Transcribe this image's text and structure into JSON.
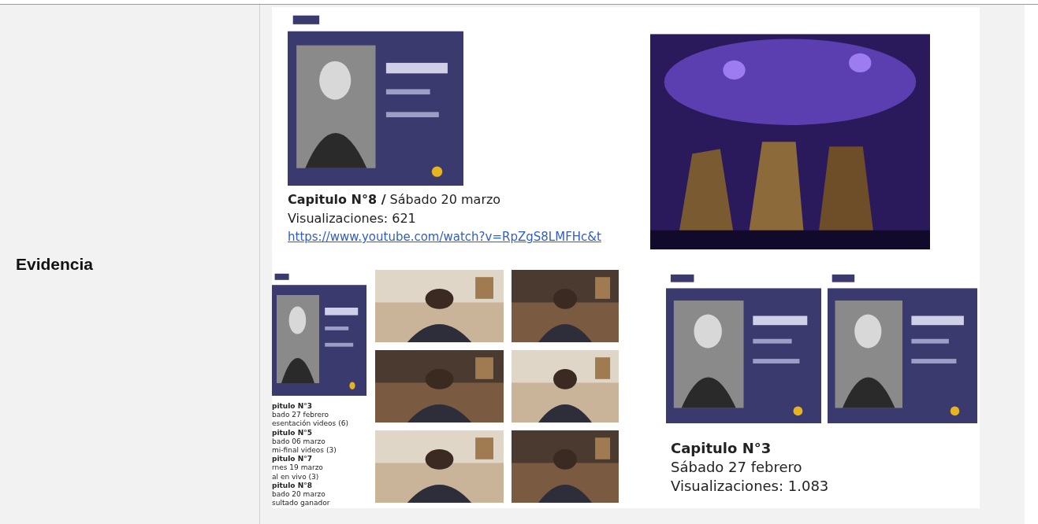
{
  "table": {
    "rows": [
      {
        "label": "Evidencia",
        "top_left_caption": {
          "title": "**Capitulo N°8 /** Sábado 20 marzo",
          "views": "Visualizaciones: 621",
          "link": "https://www.youtube.com/watch?v=RpZgS8LMFHc&t"
        },
        "strip_list": [
          {
            "kind": "heading",
            "text": "pitulo N°3"
          },
          {
            "kind": "line",
            "text": "bado 27 febrero"
          },
          {
            "kind": "line",
            "text": "esentación videos (6)"
          },
          {
            "kind": "heading",
            "text": "pitulo N°5"
          },
          {
            "kind": "line",
            "text": "bado 06 marzo"
          },
          {
            "kind": "line",
            "text": "mi-final videos (3)"
          },
          {
            "kind": "heading",
            "text": "pitulo N°7"
          },
          {
            "kind": "line",
            "text": "rnes 19 marzo"
          },
          {
            "kind": "line",
            "text": "al en vivo (3)"
          },
          {
            "kind": "heading",
            "text": "pitulo N°8"
          },
          {
            "kind": "line",
            "text": "bado 20 marzo"
          },
          {
            "kind": "line",
            "text": "sultado ganador"
          }
        ],
        "bottom_right_caption": {
          "title": "Capitulo N°3",
          "date": "Sábado 27 febrero",
          "views": "Visualizaciones: 1.083"
        }
      }
    ]
  }
}
